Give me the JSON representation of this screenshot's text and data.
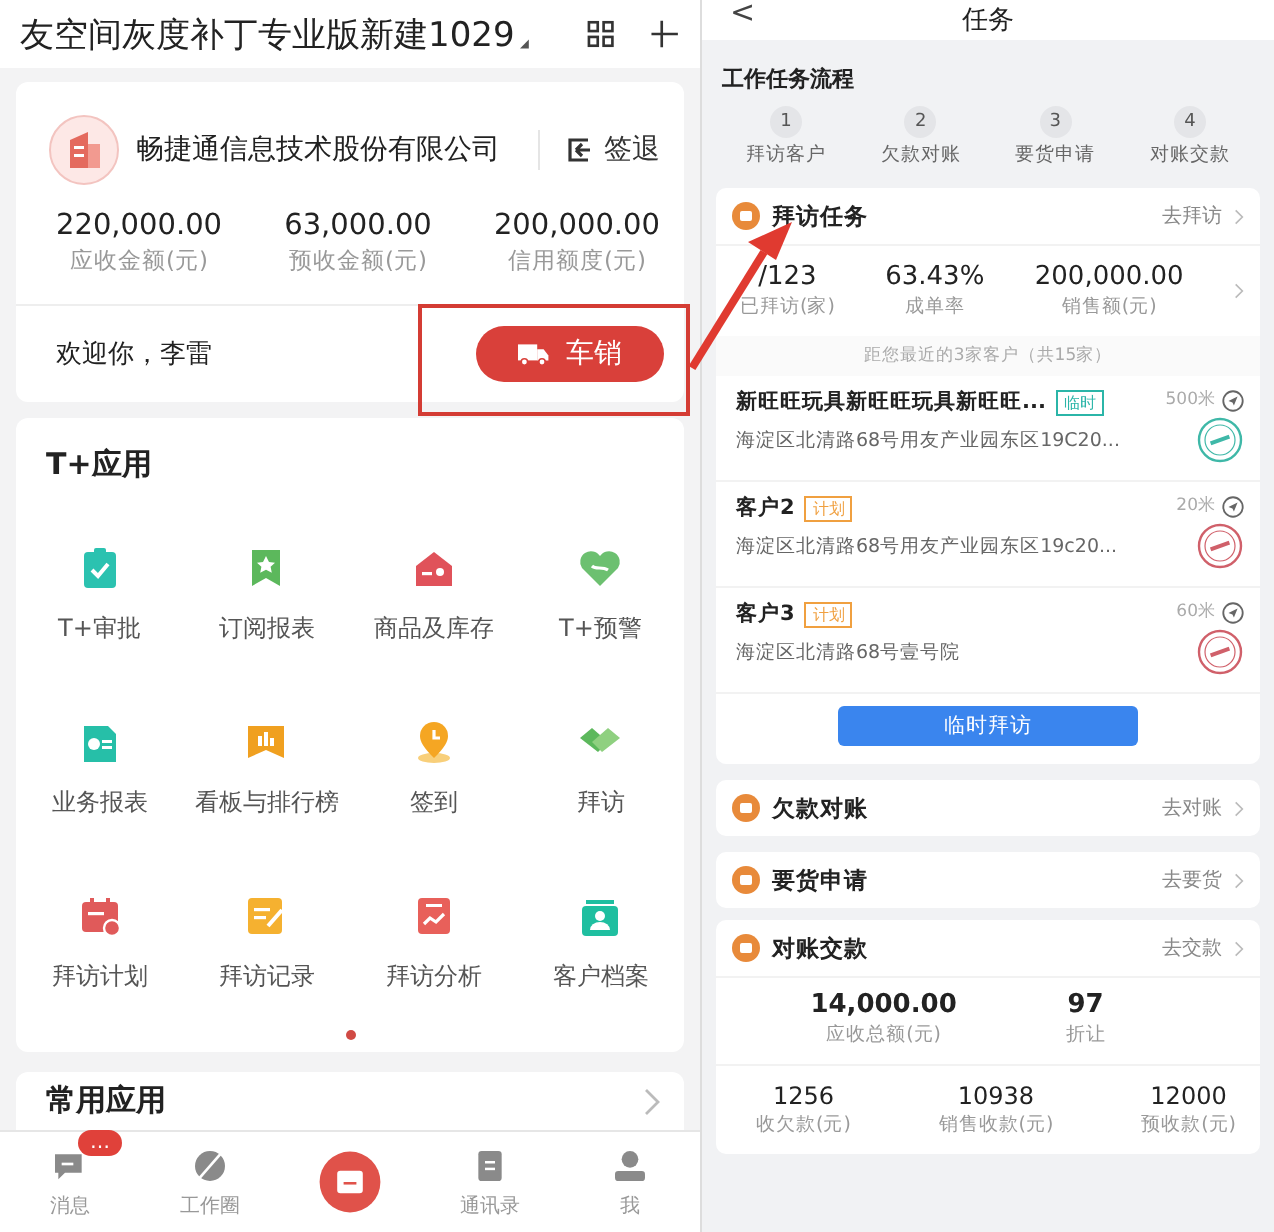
{
  "left": {
    "header": {
      "title": "友空间灰度补丁专业版新建1029"
    },
    "company": {
      "name": "畅捷通信息技术股份有限公司",
      "signout": "签退",
      "stats": [
        {
          "value": "220,000.00",
          "label": "应收金额(元)"
        },
        {
          "value": "63,000.00",
          "label": "预收金额(元)"
        },
        {
          "value": "200,000.00",
          "label": "信用额度(元)"
        }
      ],
      "welcome": "欢迎你，李雷",
      "sale_button": "车销"
    },
    "apps": {
      "title": "T+应用",
      "items": [
        "T+审批",
        "订阅报表",
        "商品及库存",
        "T+预警",
        "业务报表",
        "看板与排行榜",
        "签到",
        "拜访",
        "拜访计划",
        "拜访记录",
        "拜访分析",
        "客户档案"
      ]
    },
    "common": {
      "title": "常用应用"
    },
    "tabbar": [
      {
        "kind": "tab",
        "label": "消息",
        "badge": "…"
      },
      {
        "kind": "tab",
        "label": "工作圈"
      },
      {
        "kind": "center"
      },
      {
        "kind": "tab",
        "label": "通讯录"
      },
      {
        "kind": "tab",
        "label": "我"
      }
    ]
  },
  "right": {
    "header": {
      "back": "<",
      "title": "任务"
    },
    "flow": {
      "title": "工作任务流程",
      "steps": [
        {
          "number": "1",
          "label": "拜访客户"
        },
        {
          "number": "2",
          "label": "欠款对账"
        },
        {
          "number": "3",
          "label": "要货申请"
        },
        {
          "number": "4",
          "label": "对账交款"
        }
      ]
    },
    "visit": {
      "title": "拜访任务",
      "link": "去拜访",
      "stats": [
        {
          "value": "/123",
          "label": "已拜访(家)"
        },
        {
          "value": "63.43%",
          "label": "成单率"
        },
        {
          "value": "200,000.00",
          "label": "销售额(元)"
        }
      ],
      "note": "距您最近的3家客户（共15家）",
      "customers": [
        {
          "name": "新旺旺玩具新旺旺玩具新旺旺...",
          "tag": "临时",
          "color": "#2bb5a8",
          "distance": "500米",
          "address": "海淀区北清路68号用友产业园东区19C20...",
          "stamp": {
            "color": "#3fb8a8"
          }
        },
        {
          "name": "客户2",
          "tag": "计划",
          "color": "#f0a040",
          "distance": "20米",
          "address": "海淀区北清路68号用友产业园东区19c20...",
          "stamp": {
            "color": "#d0606a"
          }
        },
        {
          "name": "客户3",
          "tag": "计划",
          "color": "#f0a040",
          "distance": "60米",
          "address": "海淀区北清路68号壹号院",
          "stamp": {
            "color": "#d0606a"
          }
        }
      ],
      "button": "临时拜访"
    },
    "sections": [
      {
        "title": "欠款对账",
        "link": "去对账"
      },
      {
        "title": "要货申请",
        "link": "去要货"
      }
    ],
    "payment": {
      "title": "对账交款",
      "link": "去交款",
      "top": [
        {
          "value": "14,000.00",
          "label": "应收总额(元)"
        },
        {
          "value": "97",
          "label": "折让"
        }
      ],
      "bottom": [
        {
          "value": "1256",
          "label": "收欠款(元)"
        },
        {
          "value": "10938",
          "label": "销售收款(元)"
        },
        {
          "value": "12000",
          "label": "预收款(元)"
        }
      ]
    }
  }
}
